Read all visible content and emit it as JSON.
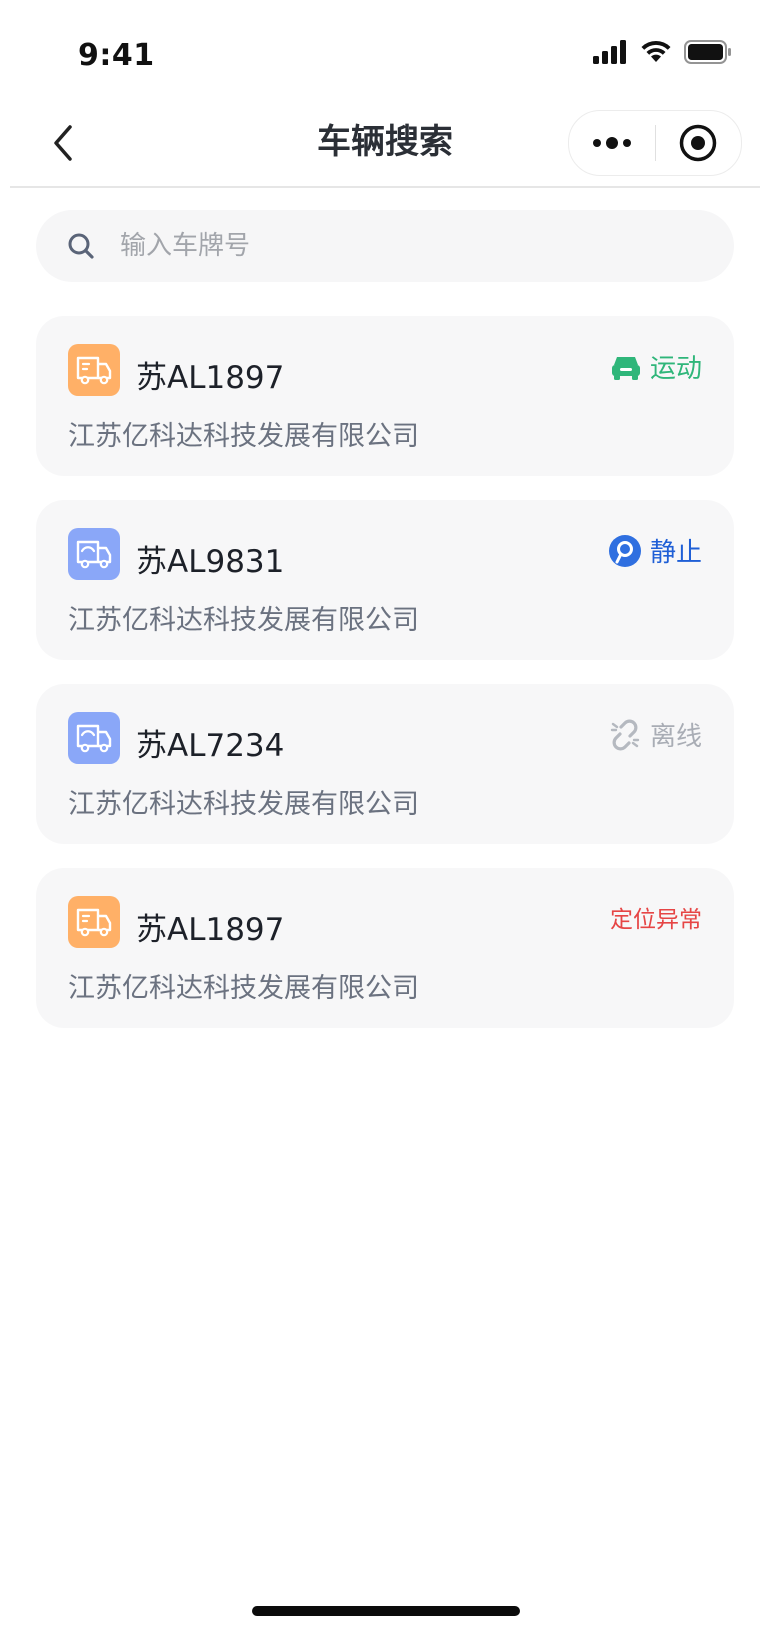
{
  "status_bar": {
    "time": "9:41"
  },
  "nav": {
    "title": "车辆搜索"
  },
  "search": {
    "placeholder": "输入车牌号",
    "value": ""
  },
  "vehicles": [
    {
      "plate": "苏AL1897",
      "company": "江苏亿科达科技发展有限公司",
      "status": "运动",
      "status_type": "moving",
      "truck_icon": "truck-orange-icon"
    },
    {
      "plate": "苏AL9831",
      "company": "江苏亿科达科技发展有限公司",
      "status": "静止",
      "status_type": "stationary",
      "truck_icon": "truck-blue-icon"
    },
    {
      "plate": "苏AL7234",
      "company": "江苏亿科达科技发展有限公司",
      "status": "离线",
      "status_type": "offline",
      "truck_icon": "truck-blue-icon"
    },
    {
      "plate": "苏AL1897",
      "company": "江苏亿科达科技发展有限公司",
      "status": "定位异常",
      "status_type": "location-error",
      "truck_icon": "truck-orange-icon"
    }
  ],
  "colors": {
    "moving": "#2fb67a",
    "stationary": "#1f5fd6",
    "offline": "#a9adb5",
    "location_error": "#e64545",
    "truck_orange": "#ffb067",
    "truck_blue": "#8aa7f8"
  }
}
